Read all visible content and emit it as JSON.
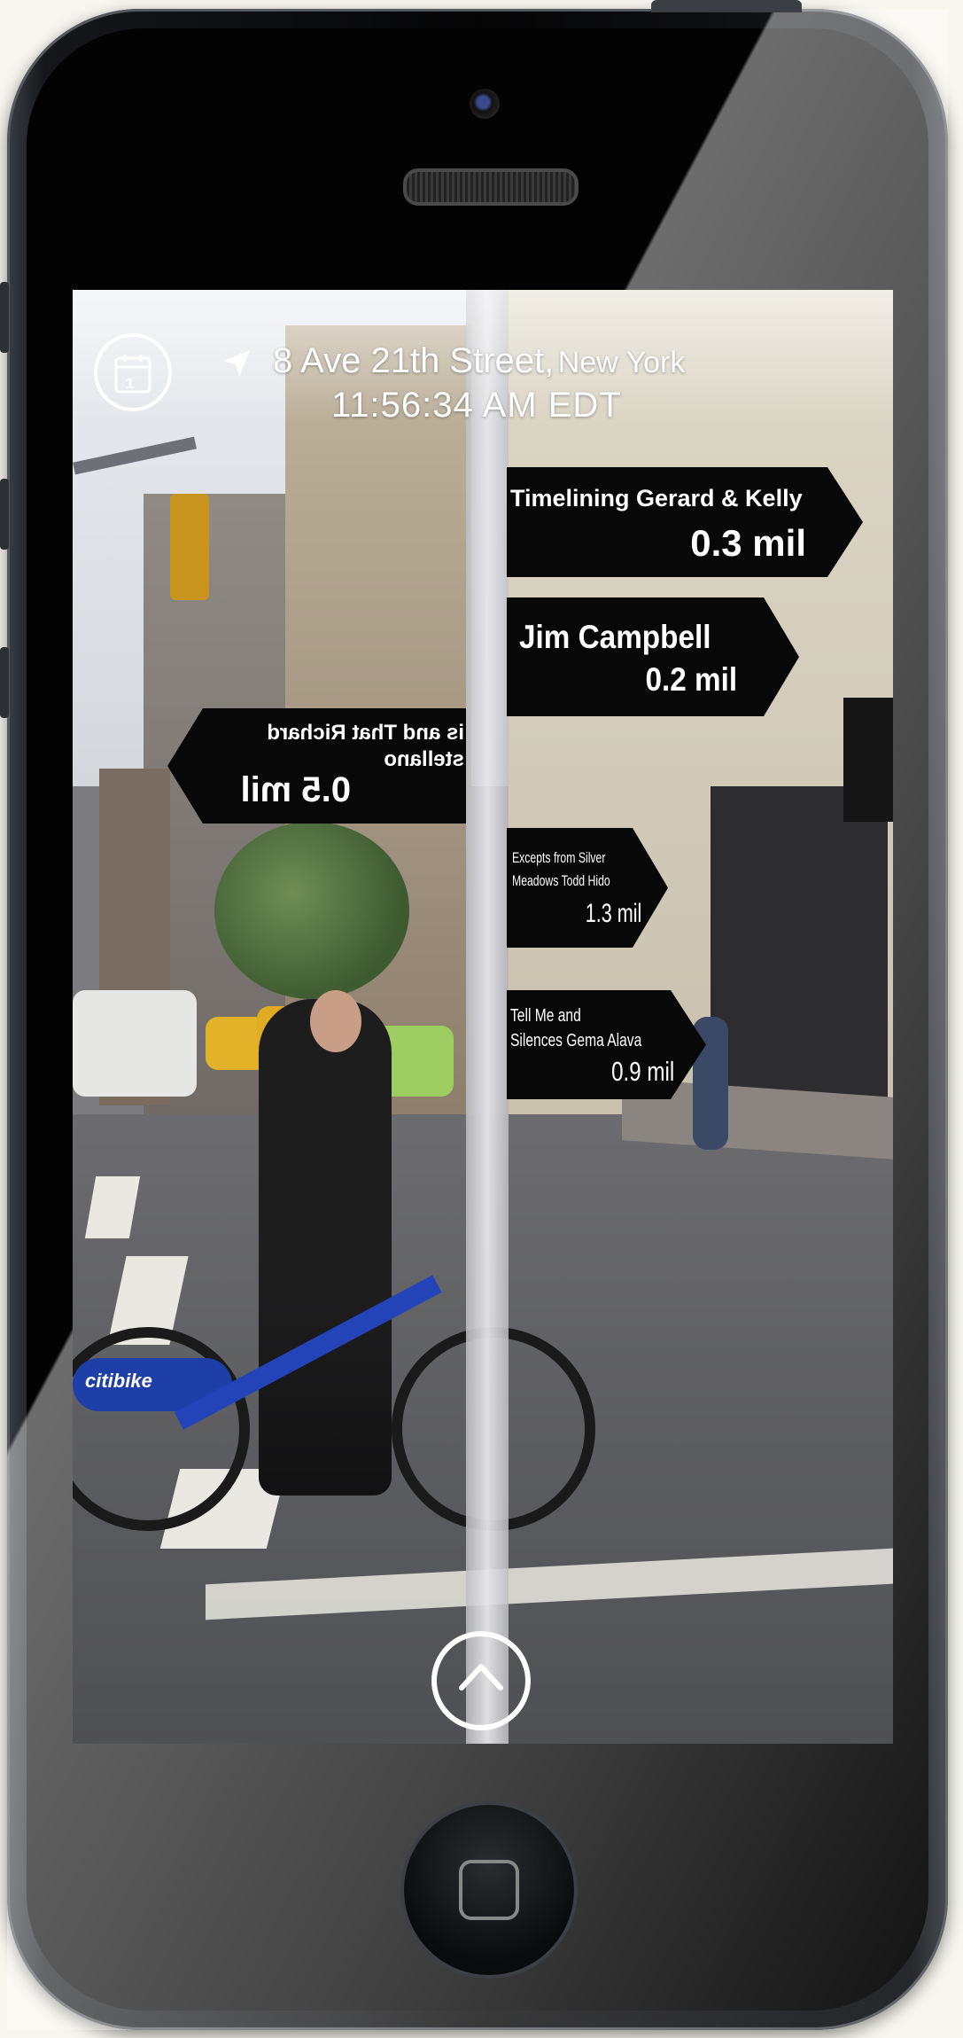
{
  "header": {
    "address_street": "8 Ave 21th Street,",
    "address_city": "New York",
    "time": "11:56:34 AM EDT",
    "calendar_day": "1"
  },
  "signs": [
    {
      "title": "Timelining Gerard & Kelly",
      "distance": "0.3 mil"
    },
    {
      "title": "Jim Campbell",
      "distance": "0.2 mil"
    },
    {
      "title_line1": "is and That Richard",
      "title_line2": "stellano",
      "distance": "0.5 mil"
    },
    {
      "title_line1": "Excepts from Silver",
      "title_line2": "Meadows Todd Hido",
      "distance": "1.3 mil"
    },
    {
      "title_line1": "Tell Me and",
      "title_line2": "Silences Gema Alava",
      "distance": "0.9 mil"
    }
  ],
  "scene_labels": {
    "bike_brand": "citibike"
  },
  "icons": {
    "calendar": "calendar-icon",
    "location": "location-arrow-icon",
    "expand": "chevron-up-icon",
    "home": "home-button-icon"
  },
  "colors": {
    "sign_bg": "#080808",
    "sign_text": "#ffffff",
    "bike_blue": "#1f3fa8"
  }
}
